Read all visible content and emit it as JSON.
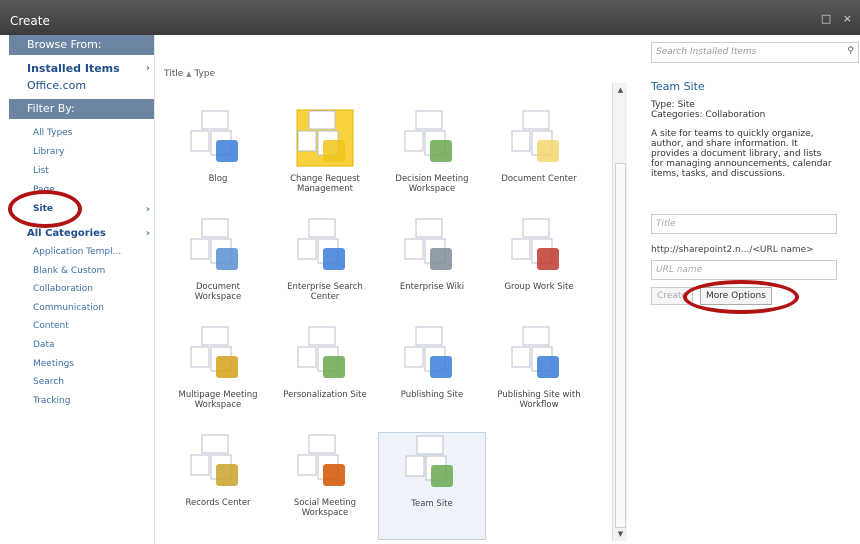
{
  "window": {
    "title": "Create",
    "controls": "□ ×"
  },
  "left": {
    "browse_from": "Browse From:",
    "installed_items": "Installed Items",
    "office_com": "Office.com",
    "filter_by": "Filter By:",
    "types": [
      "All Types",
      "Library",
      "List",
      "Page",
      "Site"
    ],
    "all_categories": "All Categories",
    "categories": [
      "Application Templ...",
      "Blank & Custom",
      "Collaboration",
      "Communication",
      "Content",
      "Data",
      "Meetings",
      "Search",
      "Tracking"
    ]
  },
  "sort": {
    "title": "Title",
    "type": "Type",
    "arrow": "▲"
  },
  "items": [
    {
      "label": "Blog"
    },
    {
      "label": "Change Request\nManagement"
    },
    {
      "label": "Decision Meeting\nWorkspace"
    },
    {
      "label": "Document Center"
    },
    {
      "label": "Document\nWorkspace"
    },
    {
      "label": "Enterprise Search\nCenter"
    },
    {
      "label": "Enterprise Wiki"
    },
    {
      "label": "Group Work Site"
    },
    {
      "label": "Multipage Meeting\nWorkspace"
    },
    {
      "label": "Personalization Site"
    },
    {
      "label": "Publishing Site"
    },
    {
      "label": "Publishing Site with\nWorkflow"
    },
    {
      "label": "Records Center"
    },
    {
      "label": "Social Meeting\nWorkspace"
    },
    {
      "label": "Team Site"
    }
  ],
  "details": {
    "search_placeholder": "Search Installed Items",
    "title": "Team Site",
    "type": "Type: Site",
    "categories": "Categories: Collaboration",
    "description": "A site for teams to quickly organize, author, and share information. It provides a document library, and lists for managing announcements, calendar items, tasks, and discussions.",
    "title_placeholder": "Title",
    "url_label": "http://sharepoint2.n.../<URL name>",
    "url_placeholder": "URL name",
    "create_label": "Create",
    "more_options_label": "More Options"
  },
  "colors": {
    "header": "#6b85a3",
    "accent": "#1f5d9c",
    "highlight": "#b11212"
  }
}
